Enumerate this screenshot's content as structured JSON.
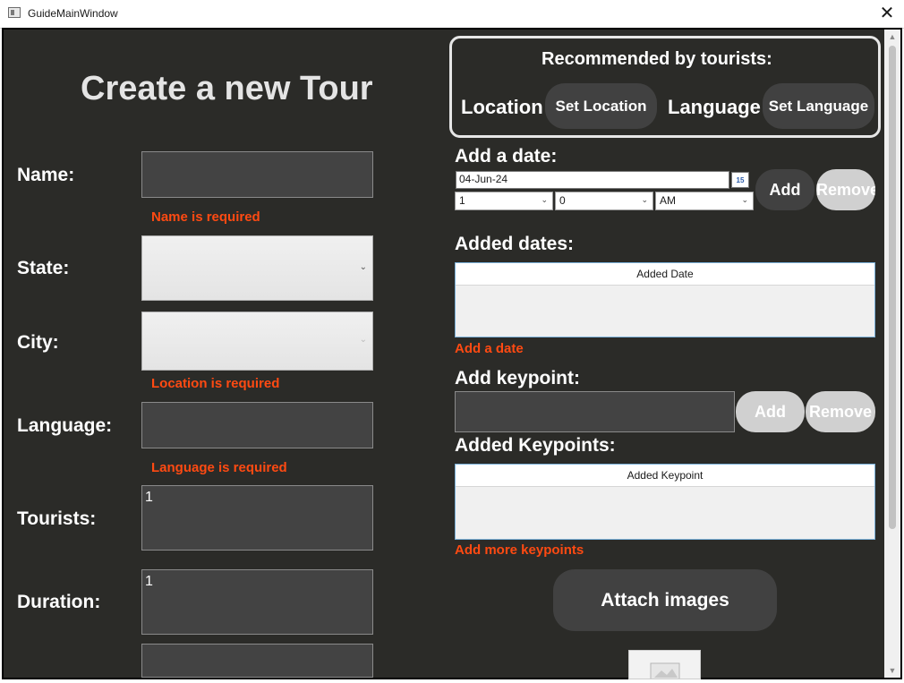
{
  "window": {
    "title": "GuideMainWindow",
    "close_glyph": "✕"
  },
  "form": {
    "heading": "Create a new Tour",
    "name_label": "Name:",
    "name_value": "",
    "name_error": "Name is required",
    "state_label": "State:",
    "city_label": "City:",
    "location_error": "Location is required",
    "language_label": "Language:",
    "language_value": "",
    "language_error": "Language is required",
    "tourists_label": "Tourists:",
    "tourists_value": "1",
    "duration_label": "Duration:",
    "duration_value": "1"
  },
  "recommended": {
    "title": "Recommended by tourists:",
    "location_label": "Location",
    "set_location_button": "Set Location",
    "language_label": "Language",
    "set_language_button": "Set Language"
  },
  "dates": {
    "add_label": "Add a date:",
    "date_value": "04-Jun-24",
    "calendar_icon_text": "15",
    "hour_value": "1",
    "minute_value": "0",
    "ampm_value": "AM",
    "add_button": "Add",
    "remove_button": "Remove",
    "added_label": "Added dates:",
    "column_header": "Added Date",
    "error": "Add a date"
  },
  "keypoints": {
    "add_label": "Add keypoint:",
    "input_value": "",
    "add_button": "Add",
    "remove_button": "Remove",
    "added_label": "Added Keypoints:",
    "column_header": "Added Keypoint",
    "error": "Add more keypoints"
  },
  "images": {
    "attach_button": "Attach images"
  },
  "icons": {
    "app": "window-app-icon",
    "close": "close-icon",
    "calendar": "calendar-icon",
    "dropdown": "chevron-down-icon"
  },
  "colors": {
    "background": "#2b2b28",
    "error": "#ff4a12",
    "field": "#434343",
    "button_dark": "#414141",
    "button_disabled": "#d0d0d0"
  }
}
